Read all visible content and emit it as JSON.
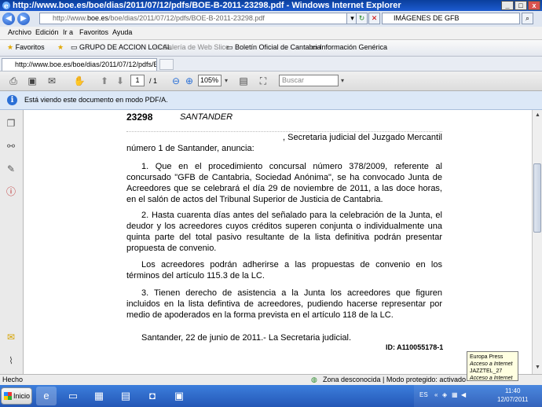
{
  "window": {
    "title": "http://www.boe.es/boe/dias/2011/07/12/pdfs/BOE-B-2011-23298.pdf - Windows Internet Explorer",
    "minimize": "_",
    "maximize": "□",
    "close": "x"
  },
  "address": {
    "url_prefix": "http://www.",
    "url_domain": "boe.es",
    "url_path": "/boe/dias/2011/07/12/pdfs/BOE-B-2011-23298.pdf",
    "search_value": "IMÁGENES DE GFB"
  },
  "menu": [
    "Archivo",
    "Edición",
    "Ir a",
    "Favoritos",
    "Ayuda"
  ],
  "favorites": {
    "label": "Favoritos",
    "items": [
      "GRUPO DE ACCION LOCAL",
      "Galería de Web Slice",
      "Boletín Oficial de Cantabria",
      "Información Genérica"
    ]
  },
  "tab": {
    "label": "http://www.boe.es/boe/dias/2011/07/12/pdfs/BOE-B..."
  },
  "pdf_toolbar": {
    "current_page": "1",
    "total_pages": "/ 1",
    "zoom": "105%",
    "search_placeholder": "Buscar"
  },
  "infobar": {
    "message": "Está viendo este documento en modo PDF/A."
  },
  "document": {
    "number": "23298",
    "city": "SANTANDER",
    "intro_line1": ", Secretaria judicial del Juzgado Mercantil",
    "intro_line2": "número 1 de Santander, anuncia:",
    "p1": "1. Que en el procedimiento concursal número 378/2009, referente al concursado \"GFB de Cantabria, Sociedad Anónima\", se ha convocado Junta de Acreedores que se celebrará el día 29 de noviembre de 2011, a las doce horas, en el salón de actos del Tribunal Superior de Justicia de Cantabria.",
    "p2": "2. Hasta cuarenta días antes del señalado para la celebración de la Junta, el deudor y los acreedores cuyos créditos superen conjunta o individualmente una quinta parte del total pasivo resultante de la lista definitiva podrán presentar propuesta de convenio.",
    "p3": "Los acreedores podrán adherirse a las propuestas de convenio en los términos del artículo 115.3 de la LC.",
    "p4": "3. Tienen derecho de asistencia a la Junta los acreedores que figuren incluidos en la lista defintiva de acreedores, pudiendo hacerse representar por medio de apoderados en la forma prevista en el artículo 118 de la LC.",
    "signature": "Santander, 22 de junio de 2011.- La Secretaria judicial.",
    "id": "ID: A110055178-1"
  },
  "statusbar": {
    "left": "Hecho",
    "zone": "Zona desconocida | Modo protegido: activado"
  },
  "taskbar": {
    "start": "Inicio",
    "lang": "ES",
    "time": "11:40",
    "date": "12/07/2011"
  },
  "notification": {
    "line1": "Europa Press",
    "line2": "Acceso a Internet",
    "line3": "JAZZTEL_27",
    "line4": "Acceso a Internet"
  }
}
